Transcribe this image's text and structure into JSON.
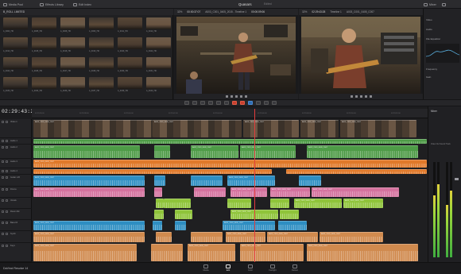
{
  "topbar": {
    "media_pool": "Media Pool",
    "effects_library": "Effects Library",
    "edit_index": "Edit Index",
    "project_title": "Quasars",
    "project_status": "Edited",
    "mixer": "Mixer",
    "inspector": "Inspector"
  },
  "media_pool": {
    "bin": "B_ROLL LIMITED",
    "clips": [
      "A_0004_HD",
      "A_0005_HD",
      "A_0008_HD",
      "A_0009_HD",
      "A_0011_HD",
      "A_0012_HD",
      "A_0014_HD",
      "A_0015_HD",
      "A_0018_HD",
      "A_0019_HD",
      "A_0020_HD",
      "A_0022_HD",
      "A_0024_HD",
      "A_0025_HD",
      "A_0027_HD",
      "A_0028_HD",
      "A_0030_HD",
      "A_0031_HD",
      "A_0033_HD",
      "A_0034_HD",
      "A_0036_HD",
      "A_0037_HD",
      "A_0039_HD",
      "A_0040_HD"
    ]
  },
  "source_viewer": {
    "zoom": "32%",
    "timecode": "00:00:37:07",
    "clip": "A003_C001_0405_2015 - Timeline 1",
    "duration": "00:00:09:06"
  },
  "timeline_viewer": {
    "zoom": "32%",
    "timecode": "02:29:43:28",
    "timeline": "Timeline 1",
    "clip": "A003_C001_0405_C007"
  },
  "inspector": {
    "rows": [
      "Video",
      "Audio",
      "File Equalizer",
      "Frequency",
      "Gain"
    ]
  },
  "timeline": {
    "timecode": "02:29:43:28",
    "ticks": [
      "02:29:36:00",
      "02:29:38:00",
      "02:29:40:00",
      "02:29:42:00",
      "02:29:44:00",
      "02:29:46:00",
      "02:29:48:00",
      "02:29:50:00",
      "02:29:52:00"
    ],
    "tracks": [
      {
        "name": "Video 1"
      },
      {
        "name": "Audio 1"
      },
      {
        "name": "Audio 2"
      },
      {
        "name": "Audio 3"
      },
      {
        "name": "Audio 4"
      },
      {
        "name": "Guitar L/R"
      },
      {
        "name": "Drums"
      },
      {
        "name": "Vocals"
      },
      {
        "name": "Room Mic"
      },
      {
        "name": "Bass DI"
      },
      {
        "name": "Synth"
      },
      {
        "name": "Keys"
      }
    ],
    "clip_label": "A003_C001_0405_C007"
  },
  "mixer": {
    "title": "Mixer",
    "bus": "Video Out Sound Track"
  },
  "bottom": {
    "brand": "DaVinci Resolve 14",
    "pages": [
      "Media",
      "Edit",
      "Color",
      "Fairlight",
      "Deliver"
    ],
    "active": "Edit"
  },
  "colors": {
    "video": "#5a8fb8",
    "audio_green": "#4e9b47",
    "audio_orange": "#e0792a",
    "audio_blue": "#2e8ec2",
    "audio_pink": "#d4729e",
    "audio_lime": "#8fc43a",
    "audio_tan": "#d08a4e",
    "playhead": "#e33c3c"
  }
}
